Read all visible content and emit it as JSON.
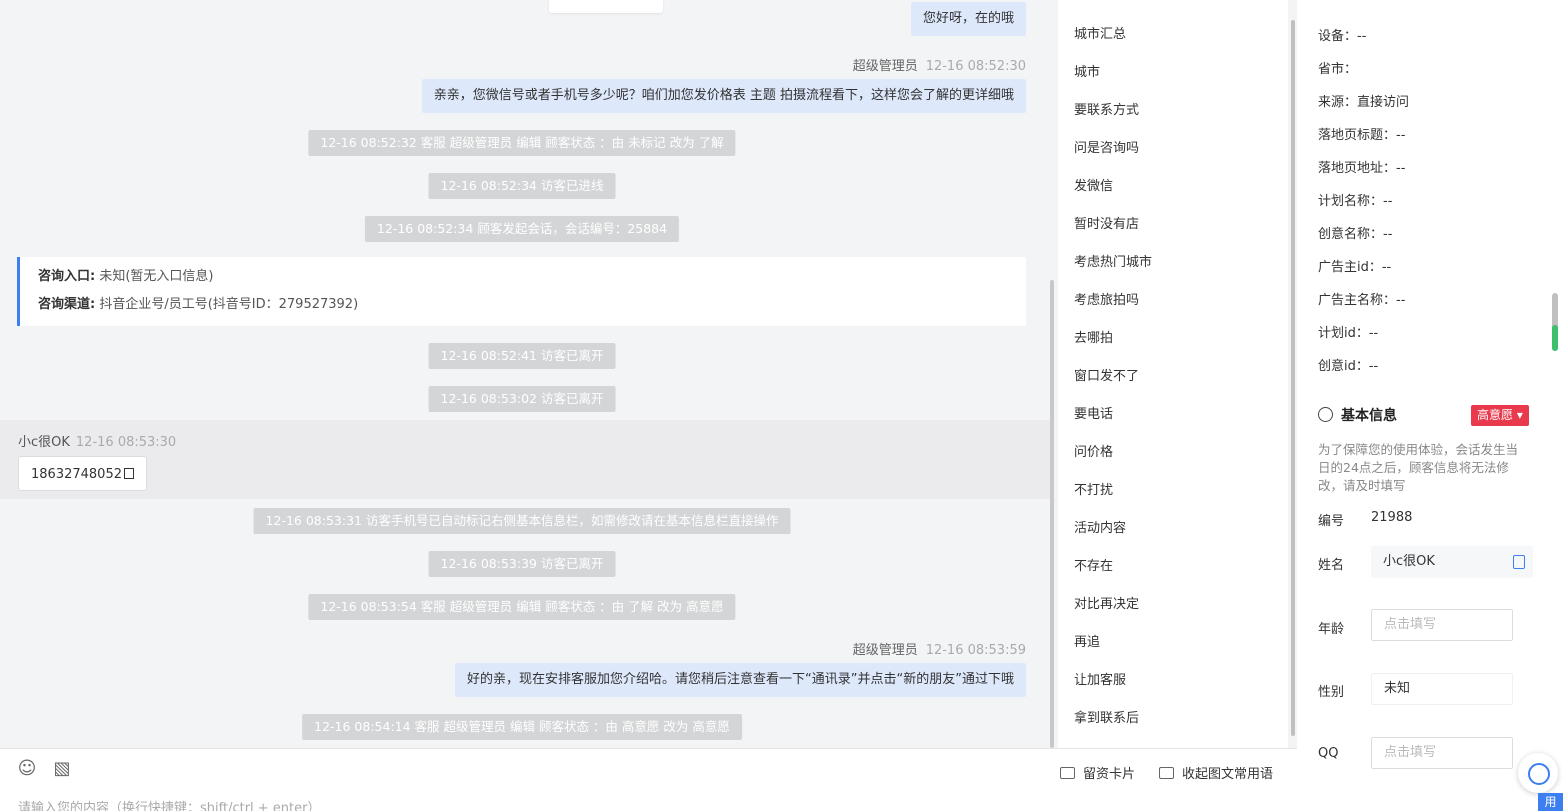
{
  "chat": {
    "msg1": "您好呀，在的哦",
    "meta2_name": "超级管理员",
    "meta2_time": "12-16 08:52:30",
    "msg2": "亲亲，您微信号或者手机号多少呢？咱们加您发价格表 主题 拍摄流程看下，这样您会了解的更详细哦",
    "sys1": "12-16 08:52:32 客服 超级管理员 编辑 顾客状态 ：由 未标记 改为 了解",
    "sys2": "12-16 08:52:34 访客已进线",
    "sys3": "12-16 08:52:34 顾客发起会话，会话编号：25884",
    "card_entry_label": "咨询入口:",
    "card_entry_value": "未知(暂无入口信息)",
    "card_channel_label": "咨询渠道:",
    "card_channel_value": "抖音企业号/员工号(抖音号ID：279527392)",
    "sys4": "12-16 08:52:41 访客已离开",
    "sys5": "12-16 08:53:02 访客已离开",
    "visitor_name": "小c很OK",
    "visitor_time": "12-16 08:53:30",
    "visitor_msg": "18632748052",
    "sys6": "12-16 08:53:31 访客手机号已自动标记右侧基本信息栏，如需修改请在基本信息栏直接操作",
    "sys7": "12-16 08:53:39 访客已离开",
    "sys8": "12-16 08:53:54 客服 超级管理员 编辑 顾客状态 ：由 了解 改为 高意愿",
    "meta3_name": "超级管理员",
    "meta3_time": "12-16 08:53:59",
    "msg3": "好的亲，现在安排客服加您介绍哈。请您稍后注意查看一下“通讯录”并点击“新的朋友”通过下哦",
    "sys9": "12-16 08:54:14 客服 超级管理员 编辑 顾客状态 ：由 高意愿 改为 高意愿"
  },
  "input": {
    "placeholder": "请输入您的内容（换行快捷键：shift/ctrl + enter）",
    "card_btn": "留资卡片",
    "collapse_btn": "收起图文常用语",
    "emoji_icon": "smile-icon",
    "image_icon": "image-icon"
  },
  "phrases": [
    "城市汇总",
    "城市",
    "要联系方式",
    "问是咨询吗",
    "发微信",
    "暂时没有店",
    "考虑热门城市",
    "考虑旅拍吗",
    "去哪拍",
    "窗口发不了",
    "要电话",
    "问价格",
    "不打扰",
    "活动内容",
    "不存在",
    "对比再决定",
    "再追",
    "让加客服",
    "拿到联系后"
  ],
  "info": {
    "fields": [
      "设备：--",
      "省市：",
      "来源：直接访问",
      "落地页标题：--",
      "落地页地址：--",
      "计划名称：--",
      "创意名称：--",
      "广告主id：--",
      "广告主名称：--",
      "计划id：--",
      "创意id：--"
    ],
    "section_title": "基本信息",
    "badge": "高意愿 ▾",
    "notice": "为了保障您的使用体验，会话发生当日的24点之后，顾客信息将无法修改，请及时填写",
    "id_label": "编号",
    "id_value": "21988",
    "name_label": "姓名",
    "name_value": "小c很OK",
    "age_label": "年龄",
    "age_placeholder": "点击填写",
    "gender_label": "性别",
    "gender_value": "未知",
    "qq_label": "QQ",
    "qq_placeholder": "点击填写",
    "use_btn": "用"
  },
  "colors": {
    "accent": "#3d7ff0",
    "badge": "#e8394d",
    "bubble": "#dde8fb",
    "system": "#d4d5d7"
  }
}
